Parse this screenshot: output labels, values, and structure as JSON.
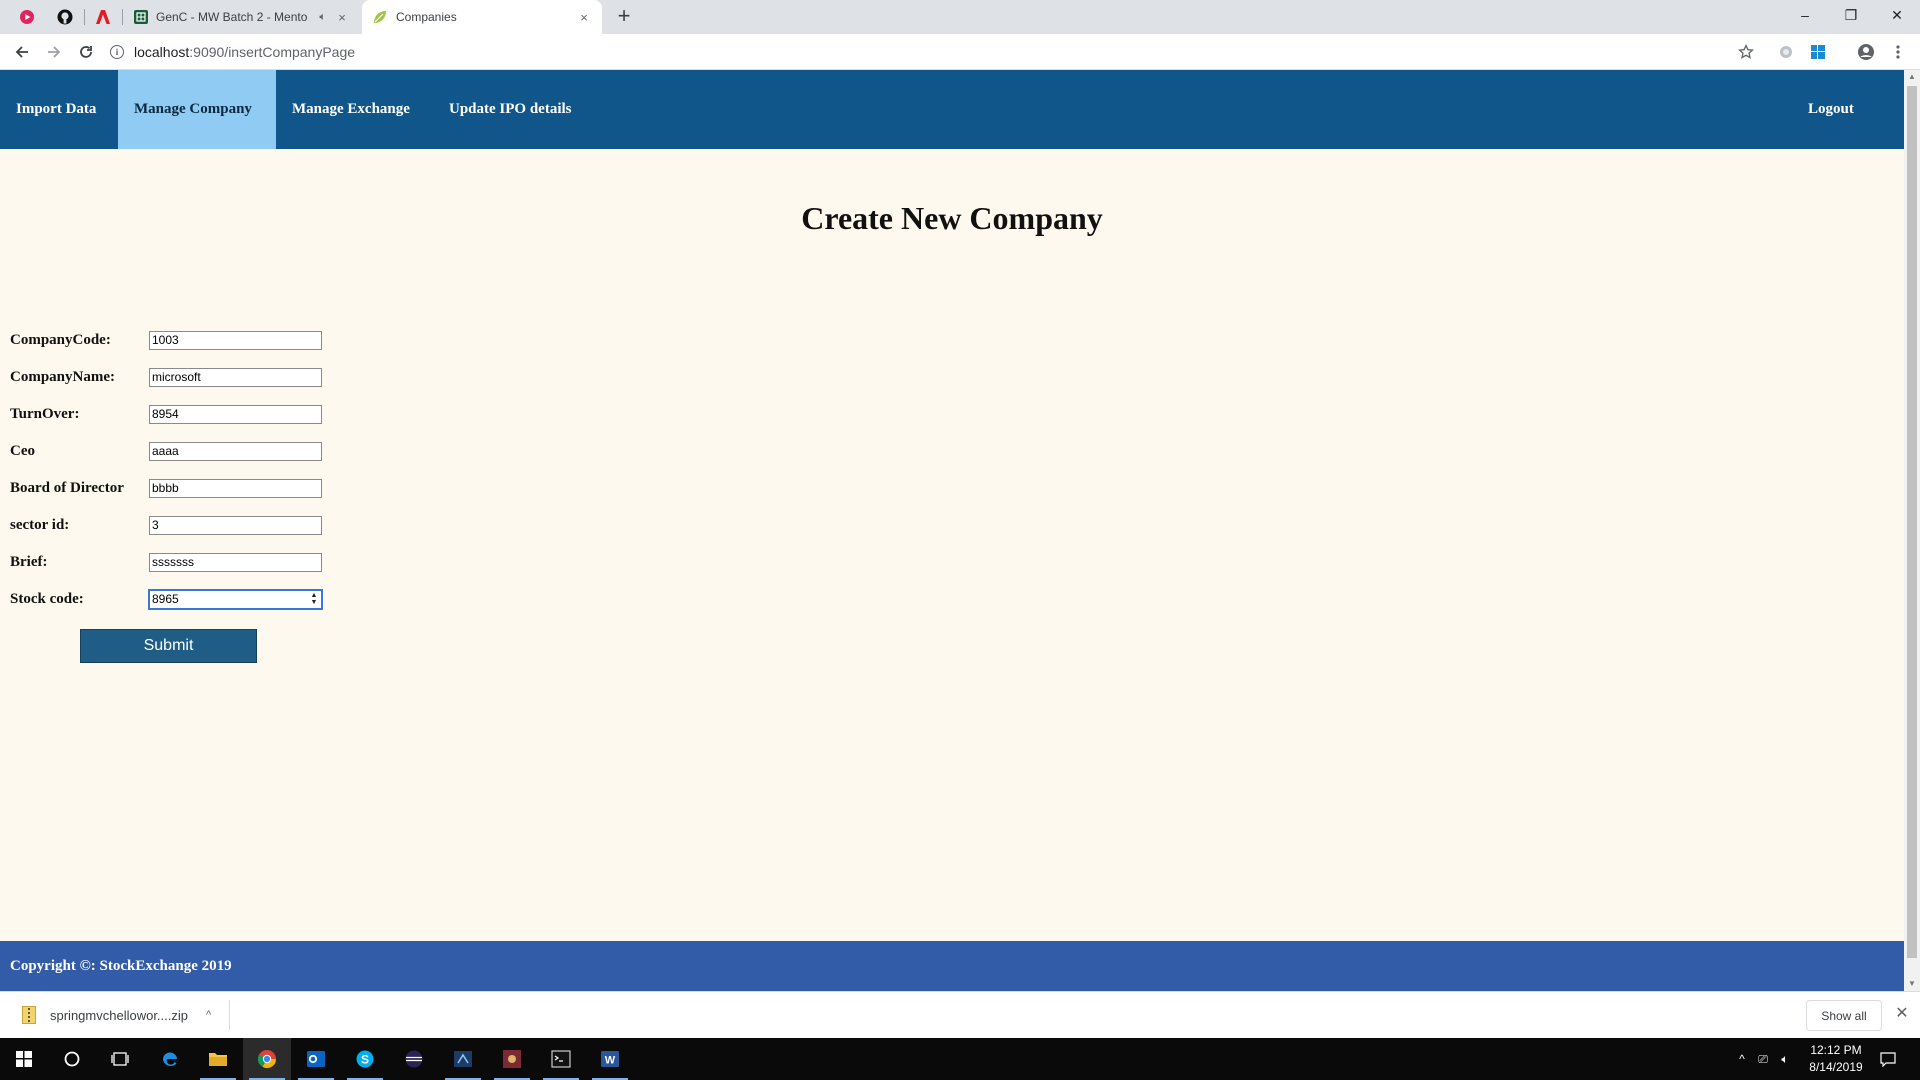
{
  "browser": {
    "tabs": [
      {
        "title": "GenC - MW Batch 2 - Mento",
        "muted_icon": "speaker-icon",
        "close": "×"
      },
      {
        "title": "Companies",
        "close": "×"
      }
    ],
    "new_tab": "+",
    "window_controls": {
      "minimize": "–",
      "restore": "❐",
      "close": "✕"
    },
    "url_host": "localhost",
    "url_path": ":9090/insertCompanyPage"
  },
  "nav": {
    "items": [
      "Import Data",
      "Manage Company",
      "Manage Exchange",
      "Update IPO details"
    ],
    "active_index": 1,
    "logout": "Logout"
  },
  "page": {
    "title": "Create New Company"
  },
  "form": {
    "fields": [
      {
        "label": "CompanyCode:",
        "value": "1003"
      },
      {
        "label": "CompanyName:",
        "value": "microsoft"
      },
      {
        "label": "TurnOver:",
        "value": "8954"
      },
      {
        "label": "Ceo",
        "value": "aaaa"
      },
      {
        "label": "Board of Director",
        "value": "bbbb"
      },
      {
        "label": "sector id:",
        "value": "3"
      },
      {
        "label": "Brief:",
        "value": "sssssss"
      },
      {
        "label": "Stock code:",
        "value": "8965"
      }
    ],
    "submit_label": "Submit"
  },
  "footer": {
    "text": "Copyright ©: StockExchange 2019"
  },
  "downloads": {
    "file_name": "springmvchellowor....zip",
    "show_all": "Show all"
  },
  "taskbar": {
    "time": "12:12 PM",
    "date": "8/14/2019"
  },
  "colors": {
    "nav_bg": "#10568a",
    "nav_active_bg": "#8fcbf3",
    "page_bg": "#fdf9ee",
    "submit_bg": "#1f5d86",
    "footer_bg": "#325ba8"
  }
}
